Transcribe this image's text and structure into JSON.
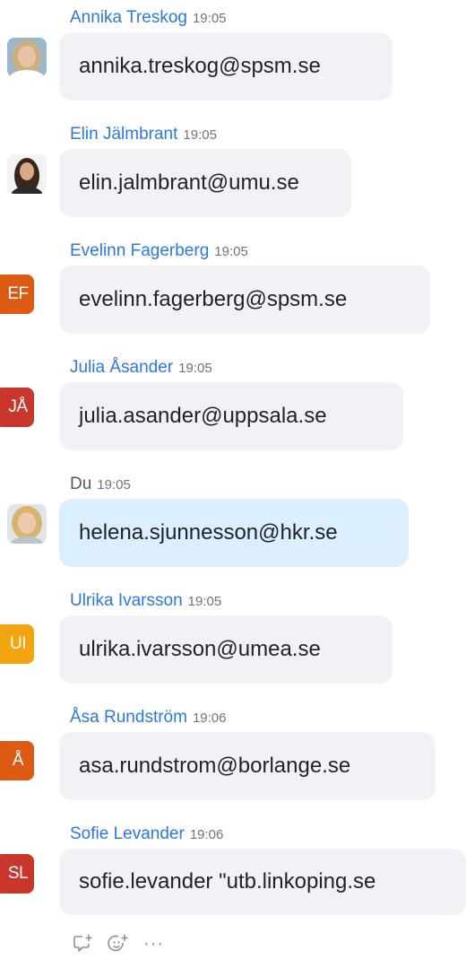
{
  "messages": [
    {
      "sender": "Annika Treskog",
      "time": "19:05",
      "text": "annika.treskog@spsm.se",
      "avatar": {
        "type": "photo",
        "bg": "#9bb7c9",
        "hair": "#cdb07f",
        "skin": "#e9c3a6"
      }
    },
    {
      "sender": "Elin Jälmbrant",
      "time": "19:05",
      "text": "elin.jalmbrant@umu.se",
      "avatar": {
        "type": "photo",
        "bg": "#f2f2f2",
        "hair": "#3a271c",
        "skin": "#d9a988"
      }
    },
    {
      "sender": "Evelinn Fagerberg",
      "time": "19:05",
      "text": "evelinn.fagerberg@spsm.se",
      "avatar": {
        "type": "initials",
        "initials": "EF",
        "color": "#dd5a12"
      }
    },
    {
      "sender": "Julia Åsander",
      "time": "19:05",
      "text": "julia.asander@uppsala.se",
      "avatar": {
        "type": "initials",
        "initials": "JÅ",
        "color": "#c9372c"
      }
    },
    {
      "sender": "Du",
      "time": "19:05",
      "text": "helena.sjunnesson@hkr.se",
      "own": true,
      "avatar": {
        "type": "photo",
        "bg": "#dfe6ea",
        "hair": "#d9b46e",
        "skin": "#efc9ad"
      }
    },
    {
      "sender": "Ulrika Ivarsson",
      "time": "19:05",
      "text": "ulrika.ivarsson@umea.se",
      "avatar": {
        "type": "initials",
        "initials": "UI",
        "color": "#f2a511"
      }
    },
    {
      "sender": "Åsa Rundström",
      "time": "19:06",
      "text": "asa.rundstrom@borlange.se",
      "avatar": {
        "type": "initials",
        "initials": "Å",
        "color": "#dd5a12"
      }
    },
    {
      "sender": "Sofie Levander",
      "time": "19:06",
      "text": "sofie.levander \"utb.linkoping.se",
      "avatar": {
        "type": "initials",
        "initials": "SL",
        "color": "#c9372c"
      }
    }
  ],
  "actions": {
    "reply_icon": "reply-plus-icon",
    "reaction_icon": "emoji-plus-icon",
    "more_label": "···"
  }
}
